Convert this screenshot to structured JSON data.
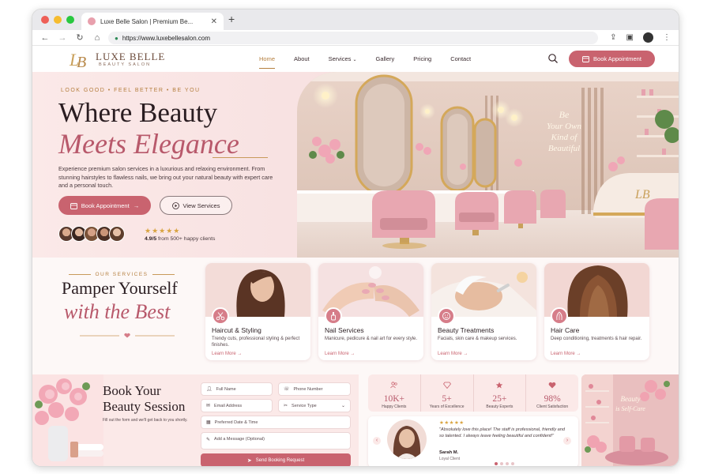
{
  "browser": {
    "tab_title": "Luxe Belle Salon | Premium Be...",
    "tab_close": "✕",
    "new_tab": "+",
    "url": "https://www.luxebellesalon.com"
  },
  "header": {
    "logo_name": "LUXE BELLE",
    "logo_sub": "BEAUTY SALON",
    "nav": [
      "Home",
      "About",
      "Services",
      "Gallery",
      "Pricing",
      "Contact"
    ],
    "cta": "Book Appointment"
  },
  "hero": {
    "eyebrow": "LOOK GOOD • FEEL BETTER • BE YOU",
    "title_line1": "Where Beauty",
    "title_line2": "Meets Elegance",
    "description": "Experience premium salon services in a luxurious and relaxing environment. From stunning hairstyles to flawless nails, we bring out your natural beauty with expert care and a personal touch.",
    "btn_book": "Book Appointment",
    "btn_view": "View Services",
    "stars": "★★★★★",
    "rating": "4.9/5",
    "rating_rest": " from 500+ happy clients",
    "neon_sign": [
      "Be",
      "Your Own",
      "Kind of",
      "Beautiful"
    ]
  },
  "services": {
    "eyebrow": "OUR SERVICES",
    "title_line1": "Pamper Yourself",
    "title_line2": "with the Best",
    "cards": [
      {
        "title": "Haircut & Styling",
        "desc": "Trendy cuts, professional styling & perfect finishes.",
        "link": "Learn More →"
      },
      {
        "title": "Nail Services",
        "desc": "Manicure, pedicure & nail art for every style.",
        "link": "Learn More →"
      },
      {
        "title": "Beauty Treatments",
        "desc": "Facials, skin care & makeup services.",
        "link": "Learn More →"
      },
      {
        "title": "Hair Care",
        "desc": "Deep conditioning, treatments & hair repair.",
        "link": "Learn More →"
      }
    ]
  },
  "booking": {
    "title_line1": "Book Your",
    "title_line2": "Beauty Session",
    "subtitle": "Fill out the form and we'll get back to you shortly.",
    "full_name": "Full Name",
    "phone": "Phone Number",
    "email": "Email Address",
    "service_type": "Service Type",
    "date_time": "Preferred Date & Time",
    "message": "Add a Message (Optional)",
    "submit": "Send Booking Request"
  },
  "stats": [
    {
      "value": "10K+",
      "label": "Happy Clients"
    },
    {
      "value": "5+",
      "label": "Years of Excellence"
    },
    {
      "value": "25+",
      "label": "Beauty Experts"
    },
    {
      "value": "98%",
      "label": "Client Satisfaction"
    }
  ],
  "testimonial": {
    "stars": "★★★★★",
    "quote": "\"Absolutely love this place! The staff is professional, friendly and so talented. I always leave feeling beautiful and confident!\"",
    "name": "Sarah M.",
    "role": "Loyal Client",
    "prev": "‹",
    "next": "›"
  },
  "promo": {
    "neon": [
      "Beauty",
      "is Self-Care"
    ]
  },
  "colors": {
    "accent": "#c9636f",
    "gold": "#b57f3f",
    "blush": "#fbe9e8"
  }
}
